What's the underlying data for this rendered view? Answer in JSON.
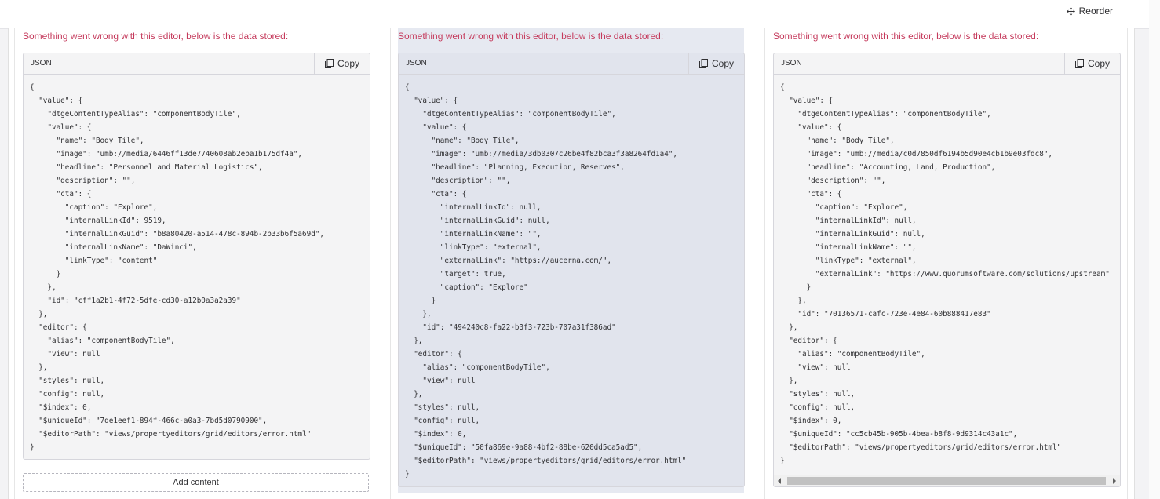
{
  "toolbar": {
    "reorder_label": "Reorder"
  },
  "editors": [
    {
      "error_message": "Something went wrong with this editor, below is the data stored:",
      "panel_label": "JSON",
      "copy_label": "Copy",
      "json_text": "{\n  \"value\": {\n    \"dtgeContentTypeAlias\": \"componentBodyTile\",\n    \"value\": {\n      \"name\": \"Body Tile\",\n      \"image\": \"umb://media/6446ff13de7740608ab2eba1b175df4a\",\n      \"headline\": \"Personnel and Material Logistics\",\n      \"description\": \"\",\n      \"cta\": {\n        \"caption\": \"Explore\",\n        \"internalLinkId\": 9519,\n        \"internalLinkGuid\": \"b8a80420-a514-478c-894b-2b33b6f5a69d\",\n        \"internalLinkName\": \"DaWinci\",\n        \"linkType\": \"content\"\n      }\n    },\n    \"id\": \"cff1a2b1-4f72-5dfe-cd30-a12b0a3a2a39\"\n  },\n  \"editor\": {\n    \"alias\": \"componentBodyTile\",\n    \"view\": null\n  },\n  \"styles\": null,\n  \"config\": null,\n  \"$index\": 0,\n  \"$uniqueId\": \"7de1eef1-894f-466c-a0a3-7bd5d0790900\",\n  \"$editorPath\": \"views/propertyeditors/grid/editors/error.html\"\n}",
      "add_content_label": "Add content"
    },
    {
      "error_message": "Something went wrong with this editor, below is the data stored:",
      "panel_label": "JSON",
      "copy_label": "Copy",
      "json_text": "{\n  \"value\": {\n    \"dtgeContentTypeAlias\": \"componentBodyTile\",\n    \"value\": {\n      \"name\": \"Body Tile\",\n      \"image\": \"umb://media/3db0307c26be4f82bca3f3a8264fd1a4\",\n      \"headline\": \"Planning, Execution, Reserves\",\n      \"description\": \"\",\n      \"cta\": {\n        \"internalLinkId\": null,\n        \"internalLinkGuid\": null,\n        \"internalLinkName\": \"\",\n        \"linkType\": \"external\",\n        \"externalLink\": \"https://aucerna.com/\",\n        \"target\": true,\n        \"caption\": \"Explore\"\n      }\n    },\n    \"id\": \"494240c8-fa22-b3f3-723b-707a31f386ad\"\n  },\n  \"editor\": {\n    \"alias\": \"componentBodyTile\",\n    \"view\": null\n  },\n  \"styles\": null,\n  \"config\": null,\n  \"$index\": 0,\n  \"$uniqueId\": \"50fa869e-9a88-4bf2-88be-620dd5ca5ad5\",\n  \"$editorPath\": \"views/propertyeditors/grid/editors/error.html\"\n}"
    },
    {
      "error_message": "Something went wrong with this editor, below is the data stored:",
      "panel_label": "JSON",
      "copy_label": "Copy",
      "json_text": "{\n  \"value\": {\n    \"dtgeContentTypeAlias\": \"componentBodyTile\",\n    \"value\": {\n      \"name\": \"Body Tile\",\n      \"image\": \"umb://media/c0d7850df6194b5d90e4cb1b9e03fdc8\",\n      \"headline\": \"Accounting, Land, Production\",\n      \"description\": \"\",\n      \"cta\": {\n        \"caption\": \"Explore\",\n        \"internalLinkId\": null,\n        \"internalLinkGuid\": null,\n        \"internalLinkName\": \"\",\n        \"linkType\": \"external\",\n        \"externalLink\": \"https://www.quorumsoftware.com/solutions/upstream\"\n      }\n    },\n    \"id\": \"70136571-cafc-723e-4e84-60b888417e83\"\n  },\n  \"editor\": {\n    \"alias\": \"componentBodyTile\",\n    \"view\": null\n  },\n  \"styles\": null,\n  \"config\": null,\n  \"$index\": 0,\n  \"$uniqueId\": \"cc5cb45b-905b-4bea-b8f8-9d9314c43a1c\",\n  \"$editorPath\": \"views/propertyeditors/grid/editors/error.html\"\n}"
    }
  ],
  "icons": {
    "reorder": "move-arrows-icon",
    "copy": "copy-icon",
    "scroll_left": "scroll-left-arrow-icon",
    "scroll_right": "scroll-right-arrow-icon"
  },
  "colors": {
    "error_text": "#c53a5c",
    "highlight_column": "#e6e9f1",
    "panel_bg": "#f4f4f5"
  }
}
